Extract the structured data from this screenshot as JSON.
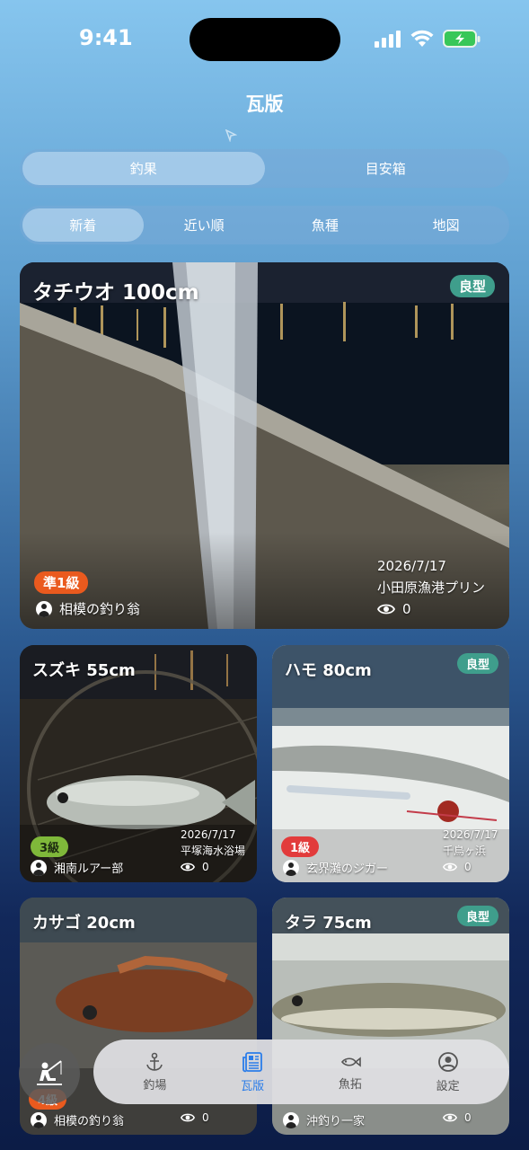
{
  "status": {
    "time": "9:41"
  },
  "nav": {
    "title": "瓦版"
  },
  "main_tabs": [
    {
      "label": "釣果",
      "active": true
    },
    {
      "label": "目安箱",
      "active": false
    }
  ],
  "sub_tabs": [
    {
      "label": "新着",
      "active": true
    },
    {
      "label": "近い順",
      "active": false
    },
    {
      "label": "魚種",
      "active": false
    },
    {
      "label": "地図",
      "active": false
    }
  ],
  "posts": [
    {
      "title": "タチウオ 100cm",
      "badge": "良型",
      "grade": "準1級",
      "grade_color": "#ea5a1e",
      "user": "相模の釣り翁",
      "date": "2026/7/17",
      "location": "小田原漁港プリン",
      "views": "0"
    },
    {
      "title": "スズキ 55cm",
      "badge": "",
      "grade": "3級",
      "grade_color": "#7fb83a",
      "user": "湘南ルアー部",
      "date": "2026/7/17",
      "location": "平塚海水浴場",
      "views": "0"
    },
    {
      "title": "ハモ 80cm",
      "badge": "良型",
      "grade": "1級",
      "grade_color": "#e23b3b",
      "user": "玄界灘のジガー",
      "date": "2026/7/17",
      "location": "千鳥ヶ浜",
      "views": "0"
    },
    {
      "title": "カサゴ 20cm",
      "badge": "",
      "grade": "4級",
      "grade_color": "#ea5a1e",
      "user": "相模の釣り翁",
      "date": "",
      "location": "",
      "views": "0"
    },
    {
      "title": "タラ 75cm",
      "badge": "良型",
      "grade": "",
      "grade_color": "#e8a21e",
      "user": "沖釣り一家",
      "date": "",
      "location": "",
      "views": "0"
    }
  ],
  "tabbar": {
    "items": [
      {
        "label": "釣場",
        "icon": "anchor-icon",
        "active": false
      },
      {
        "label": "瓦版",
        "icon": "newspaper-icon",
        "active": true
      },
      {
        "label": "魚拓",
        "icon": "fish-icon",
        "active": false
      },
      {
        "label": "設定",
        "icon": "person-circle-icon",
        "active": false
      }
    ]
  },
  "colors": {
    "accent": "#2b7de9",
    "good_badge": "#3f9e8c"
  }
}
